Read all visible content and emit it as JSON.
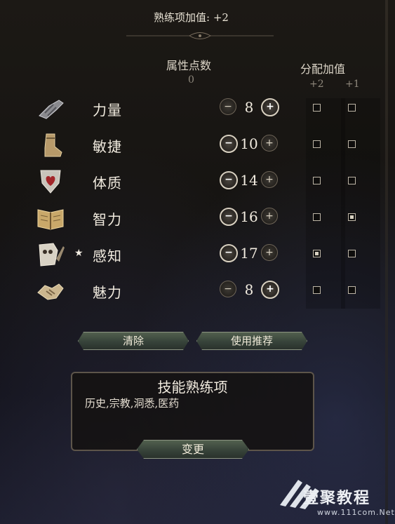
{
  "header": {
    "proficiency_bonus": "熟练项加值: +2"
  },
  "columns": {
    "ability_points_label": "属性点数",
    "ability_points_value": "0",
    "assign_bonus_label": "分配加值",
    "bonus_plus2_label": "+2",
    "bonus_plus1_label": "+1"
  },
  "abilities": [
    {
      "name": "力量",
      "score": "8",
      "minus": "−",
      "plus": "+",
      "plus2": false,
      "plus1": false,
      "icon": "gauntlet-icon",
      "star": ""
    },
    {
      "name": "敏捷",
      "score": "10",
      "minus": "−",
      "plus": "+",
      "plus2": false,
      "plus1": false,
      "icon": "boot-icon",
      "star": ""
    },
    {
      "name": "体质",
      "score": "14",
      "minus": "−",
      "plus": "+",
      "plus2": false,
      "plus1": false,
      "icon": "heart-shield-icon",
      "star": ""
    },
    {
      "name": "智力",
      "score": "16",
      "minus": "−",
      "plus": "+",
      "plus2": false,
      "plus1": true,
      "icon": "book-icon",
      "star": ""
    },
    {
      "name": "感知",
      "score": "17",
      "minus": "−",
      "plus": "+",
      "plus2": true,
      "plus1": false,
      "icon": "owl-icon",
      "star": "★"
    },
    {
      "name": "魅力",
      "score": "8",
      "minus": "−",
      "plus": "+",
      "plus2": false,
      "plus1": false,
      "icon": "handshake-icon",
      "star": ""
    }
  ],
  "actions": {
    "clear_label": "清除",
    "recommend_label": "使用推荐"
  },
  "skills": {
    "title": "技能熟练项",
    "list": "历史,宗教,洞悉,医药",
    "change_label": "变更"
  },
  "watermark": {
    "brand": "壹聚教程",
    "url": "www.111com.Net"
  },
  "colors": {
    "accent_button": "#37433a",
    "text": "#f1ebdf",
    "muted": "#8f887c"
  }
}
